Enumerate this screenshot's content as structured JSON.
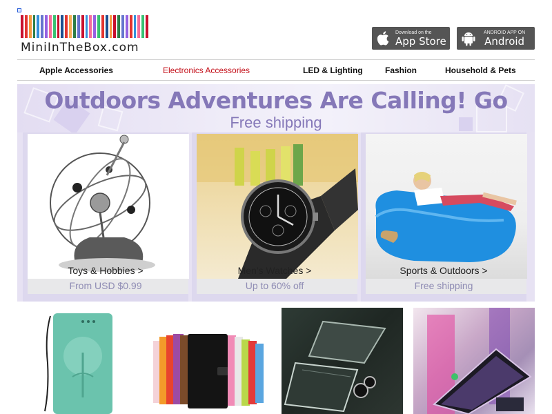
{
  "brand": {
    "name": "MiniInTheBox.com",
    "bar_colors": [
      "#c8102e",
      "#e3342f",
      "#f6993f",
      "#2d7d46",
      "#3490dc",
      "#6574cd",
      "#9561e2",
      "#f66d9b",
      "#38c172",
      "#c8102e",
      "#1b4f91",
      "#e3342f",
      "#f6ad55",
      "#2d7d46",
      "#6574cd",
      "#c8102e",
      "#3490dc",
      "#f66d9b",
      "#9561e2",
      "#38c172",
      "#e3342f",
      "#1b4f91",
      "#f6993f",
      "#c8102e",
      "#2d7d46",
      "#6574cd",
      "#9561e2",
      "#e3342f",
      "#3490dc",
      "#f66d9b",
      "#38c172",
      "#c8102e"
    ]
  },
  "apps": {
    "appstore": {
      "sub": "Download on the",
      "main": "App Store",
      "icon": "apple-icon"
    },
    "android": {
      "sub": "ANDROID APP ON",
      "main": "Android",
      "icon": "android-icon"
    }
  },
  "nav": {
    "items": [
      {
        "label": "Apple Accessories"
      },
      {
        "label": "Electronics Accessories",
        "active": true
      },
      {
        "label": "LED & Lighting"
      },
      {
        "label": "Fashion"
      },
      {
        "label": "Household & Pets"
      }
    ]
  },
  "banner": {
    "title": "Outdoors Adventures Are Calling! Go",
    "subtitle": "Free shipping",
    "cards": [
      {
        "label": "Toys & Hobbies >",
        "sub": "From USD $0.99"
      },
      {
        "label": "Men's Watches >",
        "sub": "Up to 60% off"
      },
      {
        "label": "Sports & Outdoors >",
        "sub": "Free shipping"
      }
    ]
  },
  "colors": {
    "accent_red": "#c4101a",
    "banner_purple": "#8578b8",
    "nav_text": "#111111"
  }
}
